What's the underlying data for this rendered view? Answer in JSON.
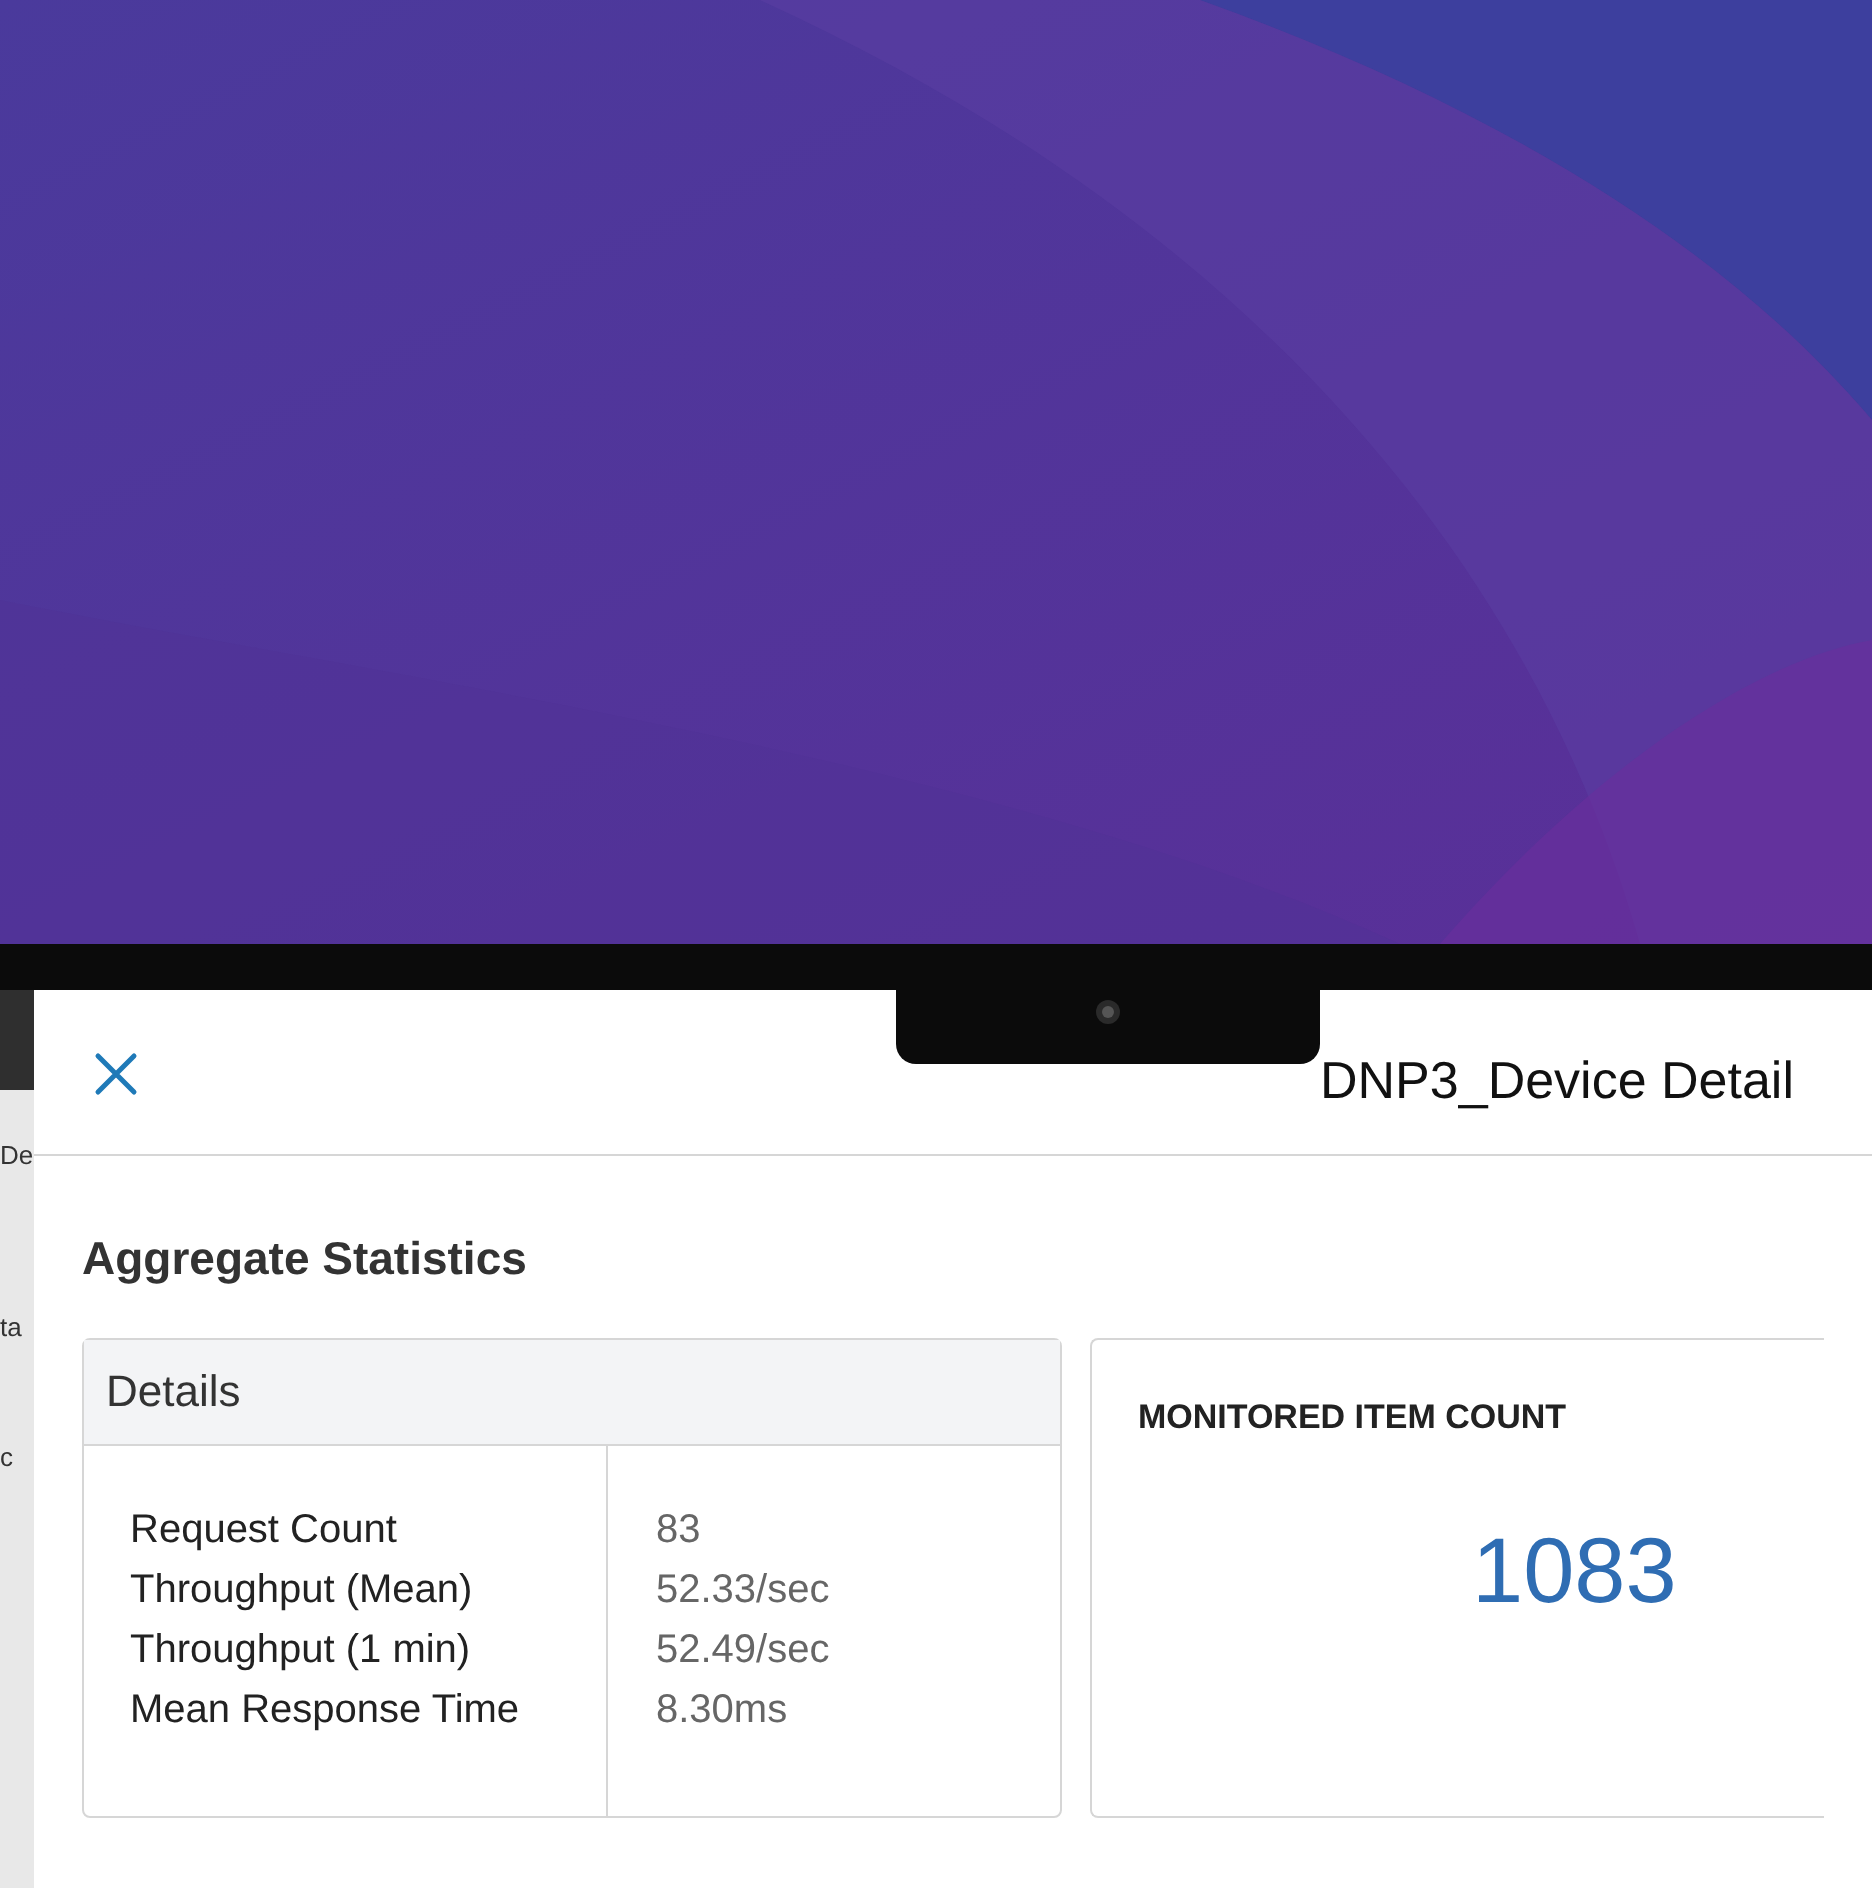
{
  "background_page": {
    "fragments": [
      "De",
      "ta",
      "c"
    ]
  },
  "dialog": {
    "title": "DNP3_Device Detail",
    "section_title": "Aggregate Statistics",
    "details": {
      "header": "Details",
      "rows": [
        {
          "label": "Request Count",
          "value": "83"
        },
        {
          "label": "Throughput (Mean)",
          "value": "52.33/sec"
        },
        {
          "label": "Throughput (1 min)",
          "value": "52.49/sec"
        },
        {
          "label": "Mean Response Time",
          "value": "8.30ms"
        }
      ]
    },
    "monitored": {
      "label": "MONITORED ITEM COUNT",
      "value": "1083"
    }
  }
}
